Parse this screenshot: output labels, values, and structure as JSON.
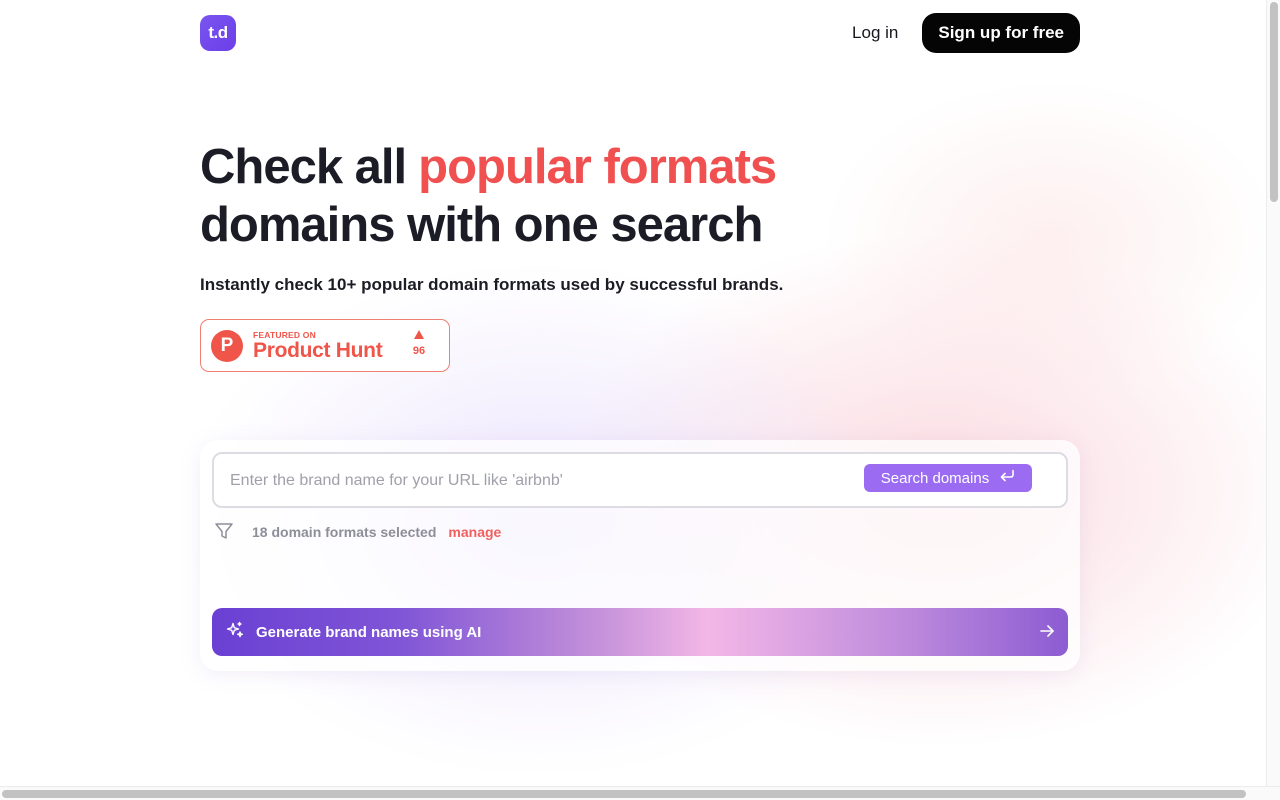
{
  "header": {
    "logo_text": "t.d",
    "login_label": "Log in",
    "signup_label": "Sign up for free"
  },
  "hero": {
    "title_part1": "Check all",
    "title_accent": "popular formats",
    "title_part2": "domains with one search",
    "subtitle": "Instantly check 10+ popular domain formats used by successful brands."
  },
  "product_hunt": {
    "letter": "P",
    "featured": "FEATURED ON",
    "name": "Product Hunt",
    "votes": "96"
  },
  "search": {
    "placeholder": "Enter the brand name for your URL like 'airbnb'",
    "value": "",
    "button_label": "Search domains",
    "formats_selected": "18 domain formats selected",
    "manage_label": "manage"
  },
  "ai": {
    "label": "Generate brand names using AI"
  },
  "colors": {
    "accent_red": "#f0504f",
    "brand_purple": "#7a55f0",
    "search_button": "#9b6cf2"
  },
  "icons": {
    "filter": "filter-funnel-icon",
    "enter": "enter-return-icon",
    "sparkles": "sparkles-icon",
    "arrow": "arrow-right-icon",
    "upvote": "upvote-triangle-icon"
  }
}
